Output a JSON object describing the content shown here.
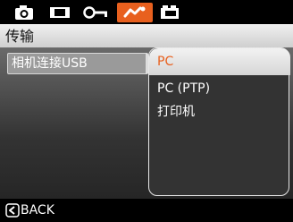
{
  "tabs": [
    {
      "icon": "camera-icon"
    },
    {
      "icon": "playback-icon"
    },
    {
      "icon": "settings-key-icon"
    },
    {
      "icon": "connection-icon",
      "active": true
    },
    {
      "icon": "battery-icon"
    }
  ],
  "title": "传输",
  "menu": {
    "label": "相机连接USB"
  },
  "options": [
    "PC",
    "PC (PTP)",
    "打印机"
  ],
  "selected_option": "PC",
  "footer": {
    "back_label": "BACK"
  },
  "colors": {
    "accent": "#e8601e",
    "title_bar": "#dcdcdc",
    "panel_border": "#e8e8e8"
  }
}
